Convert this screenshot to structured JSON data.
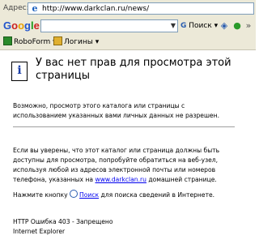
{
  "address_bar": {
    "label": "Адрес:",
    "url": "http://www.darkclan.ru/news/"
  },
  "google_toolbar": {
    "logo": "Google",
    "search_value": "",
    "search_button": "Поиск"
  },
  "roboform_toolbar": {
    "roboform_label": "RoboForm",
    "logins_label": "Логины"
  },
  "page": {
    "heading_line1": "У вас нет прав для просмотра этой",
    "heading_line2": "страницы",
    "para1_line1": "Возможно, просмотр этого каталога или страницы с",
    "para1_line2": "использованием указанных вами личных данных не разрешен.",
    "para2_line1": "Если вы уверены, что этот каталог или страница должны быть",
    "para2_line2": "доступны для просмотра, попробуйте обратиться на веб-узел,",
    "para2_line3": "используя любой из адресов электронной почты или номеров",
    "para2_line4_prefix": "телефона, указанных на",
    "para2_link": "www.darkclan.ru",
    "para2_line4_suffix": "домашней странице.",
    "search_prefix": "Нажмите кнопку",
    "search_link": "Поиск",
    "search_suffix": "для поиска сведений в Интернете.",
    "error_code": "HTTP Ошибка 403 - Запрещено",
    "browser_name": "Internet Explorer"
  }
}
